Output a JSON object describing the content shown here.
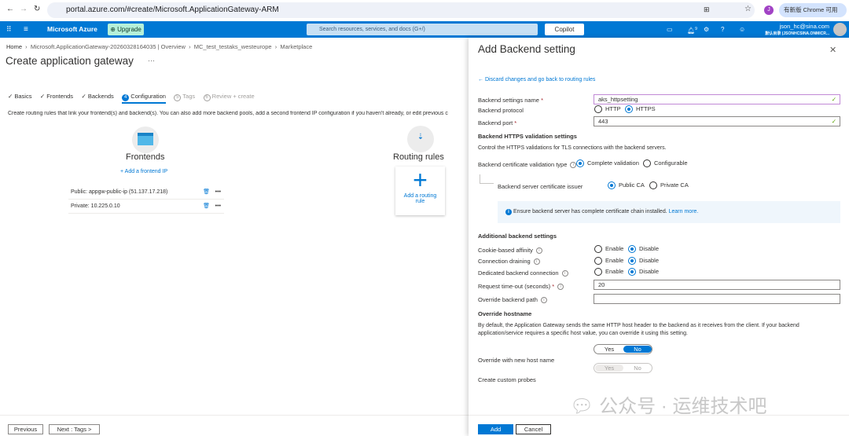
{
  "browser": {
    "url": "portal.azure.com/#create/Microsoft.ApplicationGateway-ARM",
    "profile_initial": "J",
    "update_label": "有新版 Chrome 可用"
  },
  "topbar": {
    "brand": "Microsoft Azure",
    "upgrade": "Upgrade",
    "search_placeholder": "Search resources, services, and docs (G+/)",
    "copilot": "Copilot",
    "notifications": "9",
    "user": "json_hc@sina.com",
    "directory": "默认目录 (JSONHCSINA.ONMICR..."
  },
  "breadcrumb": [
    "Home",
    "Microsoft.ApplicationGateway-20260328164035 | Overview",
    "MC_test_testaks_westeurope",
    "Marketplace"
  ],
  "page": {
    "title": "Create application gateway",
    "more": "···",
    "tabs": [
      {
        "label": "Basics",
        "state": "done"
      },
      {
        "label": "Frontends",
        "state": "done"
      },
      {
        "label": "Backends",
        "state": "done"
      },
      {
        "label": "Configuration",
        "state": "active",
        "num": "4"
      },
      {
        "label": "Tags",
        "state": "pending",
        "num": "5"
      },
      {
        "label": "Review + create",
        "state": "pending",
        "num": "6"
      }
    ],
    "description": "Create routing rules that link your frontend(s) and backend(s). You can also add more backend pools, add a second frontend IP configuration if you haven't already, or edit previous c",
    "frontends": {
      "title": "Frontends",
      "add": "+ Add a frontend IP",
      "items": [
        "Public: appgw-public-ip (51.137.17.218)",
        "Private: 10.225.0.10"
      ]
    },
    "routing": {
      "title": "Routing rules",
      "add": "Add a routing rule"
    },
    "previous": "Previous",
    "next": "Next : Tags >"
  },
  "panel": {
    "title": "Add Backend setting",
    "back_link": "← Discard changes and go back to routing rules",
    "name_label": "Backend settings name",
    "name_value": "aks_httpsetting",
    "protocol_label": "Backend protocol",
    "protocol_options": [
      "HTTP",
      "HTTPS"
    ],
    "protocol_selected": "HTTPS",
    "port_label": "Backend port",
    "port_value": "443",
    "https_heading": "Backend HTTPS validation settings",
    "https_desc": "Control the HTTPS validations for TLS connections with the backend servers.",
    "cert_type_label": "Backend certificate validation type",
    "cert_type_options": [
      "Complete validation",
      "Configurable"
    ],
    "issuer_label": "Backend server certificate issuer",
    "issuer_options": [
      "Public CA",
      "Private CA"
    ],
    "info_text": "Ensure backend server has complete certificate chain installed.",
    "info_link": "Learn more.",
    "additional_heading": "Additional backend settings",
    "settings": [
      {
        "label": "Cookie-based affinity",
        "selected": "Disable"
      },
      {
        "label": "Connection draining",
        "selected": "Disable"
      },
      {
        "label": "Dedicated backend connection",
        "selected": "Disable"
      }
    ],
    "enable": "Enable",
    "disable": "Disable",
    "timeout_label": "Request time-out (seconds)",
    "timeout_value": "20",
    "path_label": "Override backend path",
    "path_value": "",
    "hostname_heading": "Override hostname",
    "hostname_desc": "By default, the Application Gateway sends the same HTTP host header to the backend as it receives from the client. If your backend application/service requires a specific host value, you can override it using this setting.",
    "override_label": "Override with new host name",
    "override_value": "No",
    "probes_label": "Create custom probes",
    "probes_value": "Yes",
    "yes": "Yes",
    "no": "No",
    "add": "Add",
    "cancel": "Cancel"
  },
  "watermark": "公众号 · 运维技术吧",
  "colors": {
    "azure_blue": "#0078d4",
    "success": "#57a300"
  }
}
